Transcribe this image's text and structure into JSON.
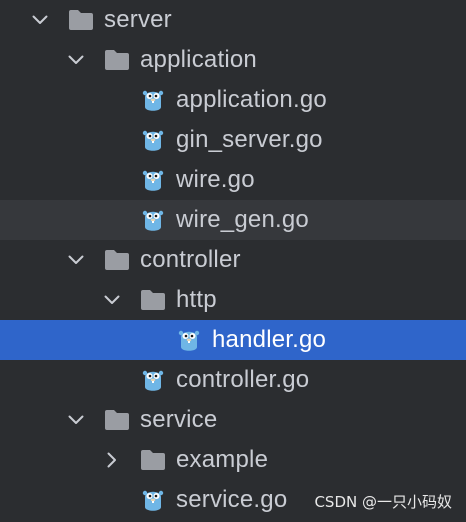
{
  "tree": {
    "items": [
      {
        "label": "server",
        "type": "folder",
        "expanded": true,
        "depth": 0,
        "icon": "folder-icon"
      },
      {
        "label": "application",
        "type": "folder",
        "expanded": true,
        "depth": 1,
        "icon": "folder-icon"
      },
      {
        "label": "application.go",
        "type": "file",
        "depth": 2,
        "icon": "go-gopher-icon"
      },
      {
        "label": "gin_server.go",
        "type": "file",
        "depth": 2,
        "icon": "go-gopher-icon"
      },
      {
        "label": "wire.go",
        "type": "file",
        "depth": 2,
        "icon": "go-gopher-icon"
      },
      {
        "label": "wire_gen.go",
        "type": "file",
        "depth": 2,
        "icon": "go-gopher-icon",
        "hovered": true
      },
      {
        "label": "controller",
        "type": "folder",
        "expanded": true,
        "depth": 1,
        "icon": "folder-icon"
      },
      {
        "label": "http",
        "type": "folder",
        "expanded": true,
        "depth": 2,
        "icon": "folder-icon"
      },
      {
        "label": "handler.go",
        "type": "file",
        "depth": 3,
        "icon": "go-gopher-icon",
        "selected": true
      },
      {
        "label": "controller.go",
        "type": "file",
        "depth": 2,
        "icon": "go-gopher-icon"
      },
      {
        "label": "service",
        "type": "folder",
        "expanded": true,
        "depth": 1,
        "icon": "folder-icon"
      },
      {
        "label": "example",
        "type": "folder",
        "expanded": false,
        "depth": 2,
        "icon": "folder-icon"
      },
      {
        "label": "service.go",
        "type": "file",
        "depth": 2,
        "icon": "go-gopher-icon"
      }
    ]
  },
  "watermark": "CSDN @一只小码奴",
  "colors": {
    "background": "#2b2d30",
    "text": "#c9ccd3",
    "selected_background": "#2f65ca",
    "hover_background": "#36383c",
    "folder": "#9a9da3",
    "gopher": "#6fb6e6"
  }
}
